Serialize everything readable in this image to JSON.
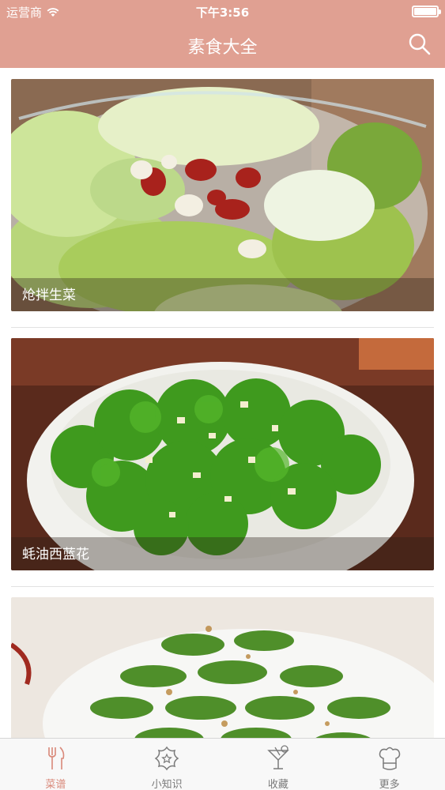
{
  "status_bar": {
    "carrier": "运营商",
    "time": "下午3:56",
    "battery_level": 1.0
  },
  "nav": {
    "title": "素食大全",
    "search_icon": "search-icon"
  },
  "recipes": [
    {
      "caption": "炝拌生菜"
    },
    {
      "caption": "蚝油西蓝花"
    },
    {
      "caption": ""
    }
  ],
  "tab_bar": {
    "tabs": [
      {
        "label": "菜谱",
        "icon": "fork-knife-icon",
        "active": true
      },
      {
        "label": "小知识",
        "icon": "flower-star-icon",
        "active": false
      },
      {
        "label": "收藏",
        "icon": "cocktail-icon",
        "active": false
      },
      {
        "label": "更多",
        "icon": "chef-hat-icon",
        "active": false
      }
    ]
  },
  "colors": {
    "nav_background": "#e0a092",
    "tab_active": "#d9897a",
    "tab_inactive": "#7a7a7a"
  }
}
